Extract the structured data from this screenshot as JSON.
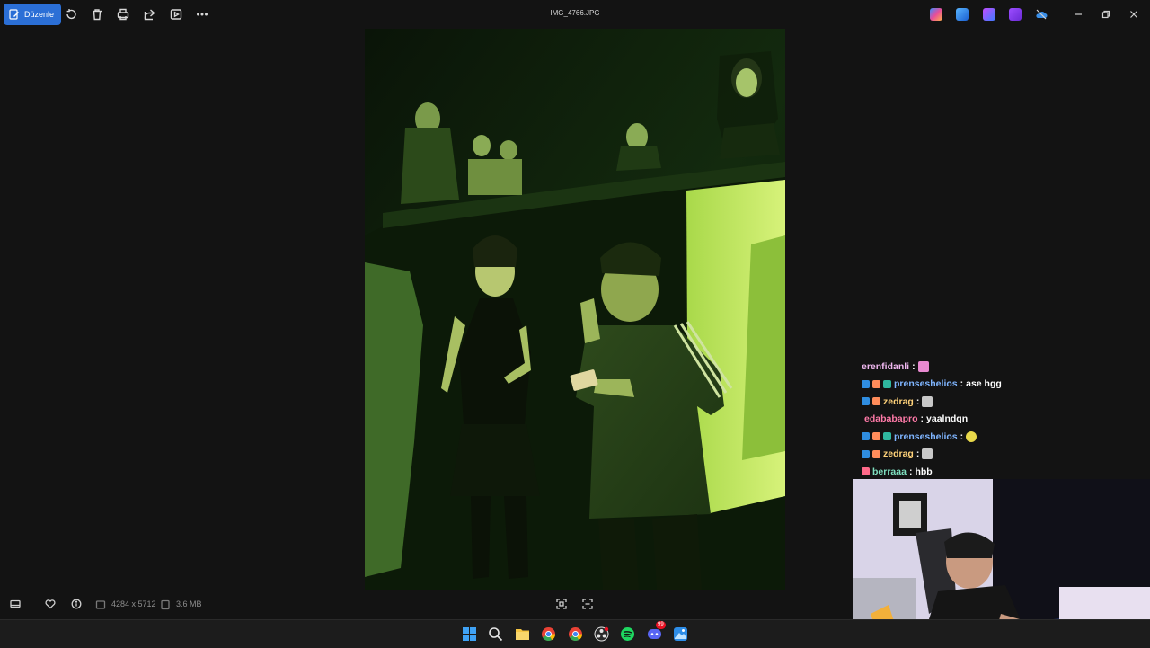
{
  "app": {
    "title": "IMG_4766.JPG",
    "edit_label": "Düzenle"
  },
  "toolbar": {
    "icons": [
      "edit-icon",
      "rotate-icon",
      "delete-icon",
      "print-icon",
      "share-icon",
      "slideshow-icon",
      "more-icon"
    ]
  },
  "tray": {
    "icons": [
      "copilot-icon",
      "photos-icon",
      "clipchamp-icon",
      "video-editor-icon",
      "onedrive-icon"
    ]
  },
  "window_controls": [
    "minimize",
    "maximize",
    "close"
  ],
  "status": {
    "dimensions": "4284 x 5712",
    "file_size": "3.6 MB"
  },
  "taskbar": {
    "items": [
      "windows-start",
      "search",
      "file-explorer",
      "chrome",
      "chrome-profile",
      "obs",
      "spotify",
      "discord",
      "photos"
    ],
    "discord_badge": "99"
  },
  "chat": {
    "messages": [
      {
        "user": "erenfidanli",
        "text": "",
        "color": "#f0b8f0"
      },
      {
        "user": "prenseshelios",
        "text": "ase hgg",
        "color": "#7fb5ff"
      },
      {
        "user": "zedrag",
        "text": "",
        "color": "#ffd27a"
      },
      {
        "user": "edababapro",
        "text": "yaalndqn",
        "color": "#ff7aa8"
      },
      {
        "user": "prenseshelios",
        "text": "",
        "color": "#7fb5ff"
      },
      {
        "user": "zedrag",
        "text": "",
        "color": "#ffd27a"
      },
      {
        "user": "berraaa",
        "text": "hbb",
        "color": "#7fe0c0"
      }
    ],
    "separator": ":"
  },
  "colors": {
    "accent": "#2b6fd6",
    "background": "#131313",
    "taskbar": "#1c1c1c"
  }
}
